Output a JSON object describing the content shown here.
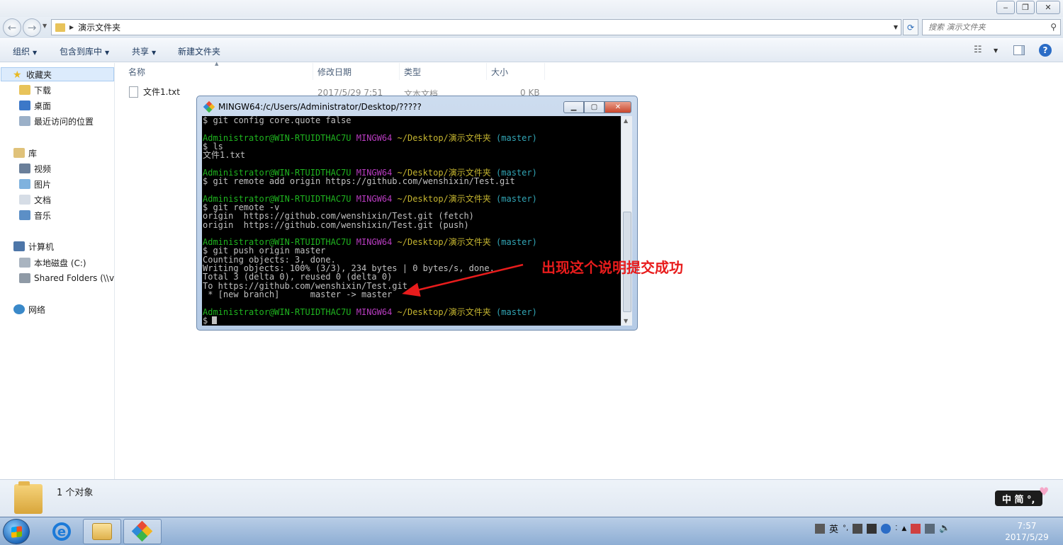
{
  "explorer": {
    "address_path": "演示文件夹",
    "search_placeholder": "搜索 演示文件夹",
    "toolbar": {
      "organize": "组织",
      "include_in_library": "包含到库中",
      "share": "共享",
      "new_folder": "新建文件夹"
    },
    "nav": {
      "favorites": "收藏夹",
      "downloads": "下载",
      "desktop": "桌面",
      "recent": "最近访问的位置",
      "libraries": "库",
      "videos": "视频",
      "pictures": "图片",
      "documents": "文档",
      "music": "音乐",
      "computer": "计算机",
      "local_disk": "本地磁盘 (C:)",
      "shared_folders": "Shared Folders (\\\\v",
      "network": "网络"
    },
    "columns": {
      "name": "名称",
      "modified": "修改日期",
      "type": "类型",
      "size": "大小"
    },
    "files": [
      {
        "name": "文件1.txt",
        "modified": "2017/5/29 7:51",
        "type": "文本文档",
        "size": "0 KB"
      }
    ],
    "status": "1 个对象"
  },
  "terminal": {
    "title": "MINGW64:/c/Users/Administrator/Desktop/?????",
    "lines": [
      {
        "segs": [
          [
            "$ git config core.quote false",
            "w"
          ]
        ]
      },
      {
        "segs": []
      },
      {
        "segs": [
          [
            "Administrator@WIN-RTUIDTHAC7U",
            "g"
          ],
          [
            " MINGW64",
            "m"
          ],
          [
            " ~/Desktop/演示文件夹",
            "y"
          ],
          [
            " (master)",
            "c"
          ]
        ]
      },
      {
        "segs": [
          [
            "$ ls",
            "w"
          ]
        ]
      },
      {
        "segs": [
          [
            "文件1.txt",
            "w"
          ]
        ]
      },
      {
        "segs": []
      },
      {
        "segs": [
          [
            "Administrator@WIN-RTUIDTHAC7U",
            "g"
          ],
          [
            " MINGW64",
            "m"
          ],
          [
            " ~/Desktop/演示文件夹",
            "y"
          ],
          [
            " (master)",
            "c"
          ]
        ]
      },
      {
        "segs": [
          [
            "$ git remote add origin https://github.com/wenshixin/Test.git",
            "w"
          ]
        ]
      },
      {
        "segs": []
      },
      {
        "segs": [
          [
            "Administrator@WIN-RTUIDTHAC7U",
            "g"
          ],
          [
            " MINGW64",
            "m"
          ],
          [
            " ~/Desktop/演示文件夹",
            "y"
          ],
          [
            " (master)",
            "c"
          ]
        ]
      },
      {
        "segs": [
          [
            "$ git remote -v",
            "w"
          ]
        ]
      },
      {
        "segs": [
          [
            "origin  https://github.com/wenshixin/Test.git (fetch)",
            "w"
          ]
        ]
      },
      {
        "segs": [
          [
            "origin  https://github.com/wenshixin/Test.git (push)",
            "w"
          ]
        ]
      },
      {
        "segs": []
      },
      {
        "segs": [
          [
            "Administrator@WIN-RTUIDTHAC7U",
            "g"
          ],
          [
            " MINGW64",
            "m"
          ],
          [
            " ~/Desktop/演示文件夹",
            "y"
          ],
          [
            " (master)",
            "c"
          ]
        ]
      },
      {
        "segs": [
          [
            "$ git push origin master",
            "w"
          ]
        ]
      },
      {
        "segs": [
          [
            "Counting objects: 3, done.",
            "w"
          ]
        ]
      },
      {
        "segs": [
          [
            "Writing objects: 100% (3/3), 234 bytes | 0 bytes/s, done.",
            "w"
          ]
        ]
      },
      {
        "segs": [
          [
            "Total 3 (delta 0), reused 0 (delta 0)",
            "w"
          ]
        ]
      },
      {
        "segs": [
          [
            "To https://github.com/wenshixin/Test.git",
            "w"
          ]
        ]
      },
      {
        "segs": [
          [
            " * [new branch]      master -> master",
            "w"
          ]
        ]
      },
      {
        "segs": []
      },
      {
        "segs": [
          [
            "Administrator@WIN-RTUIDTHAC7U",
            "g"
          ],
          [
            " MINGW64",
            "m"
          ],
          [
            " ~/Desktop/演示文件夹",
            "y"
          ],
          [
            " (master)",
            "c"
          ]
        ]
      },
      {
        "segs": [
          [
            "$",
            "w"
          ]
        ],
        "cursor": true
      }
    ]
  },
  "annotation": "出现这个说明提交成功",
  "ime": "中 简 °,",
  "taskbar": {
    "clock_time": "7:57",
    "clock_date": "2017/5/29",
    "tray_lang": "英"
  },
  "colors": {
    "annotation": "#e81c1c",
    "prompt_user": "#1fb51f",
    "prompt_env": "#b83cc0",
    "prompt_path": "#c5b530",
    "prompt_branch": "#32a6b6"
  }
}
